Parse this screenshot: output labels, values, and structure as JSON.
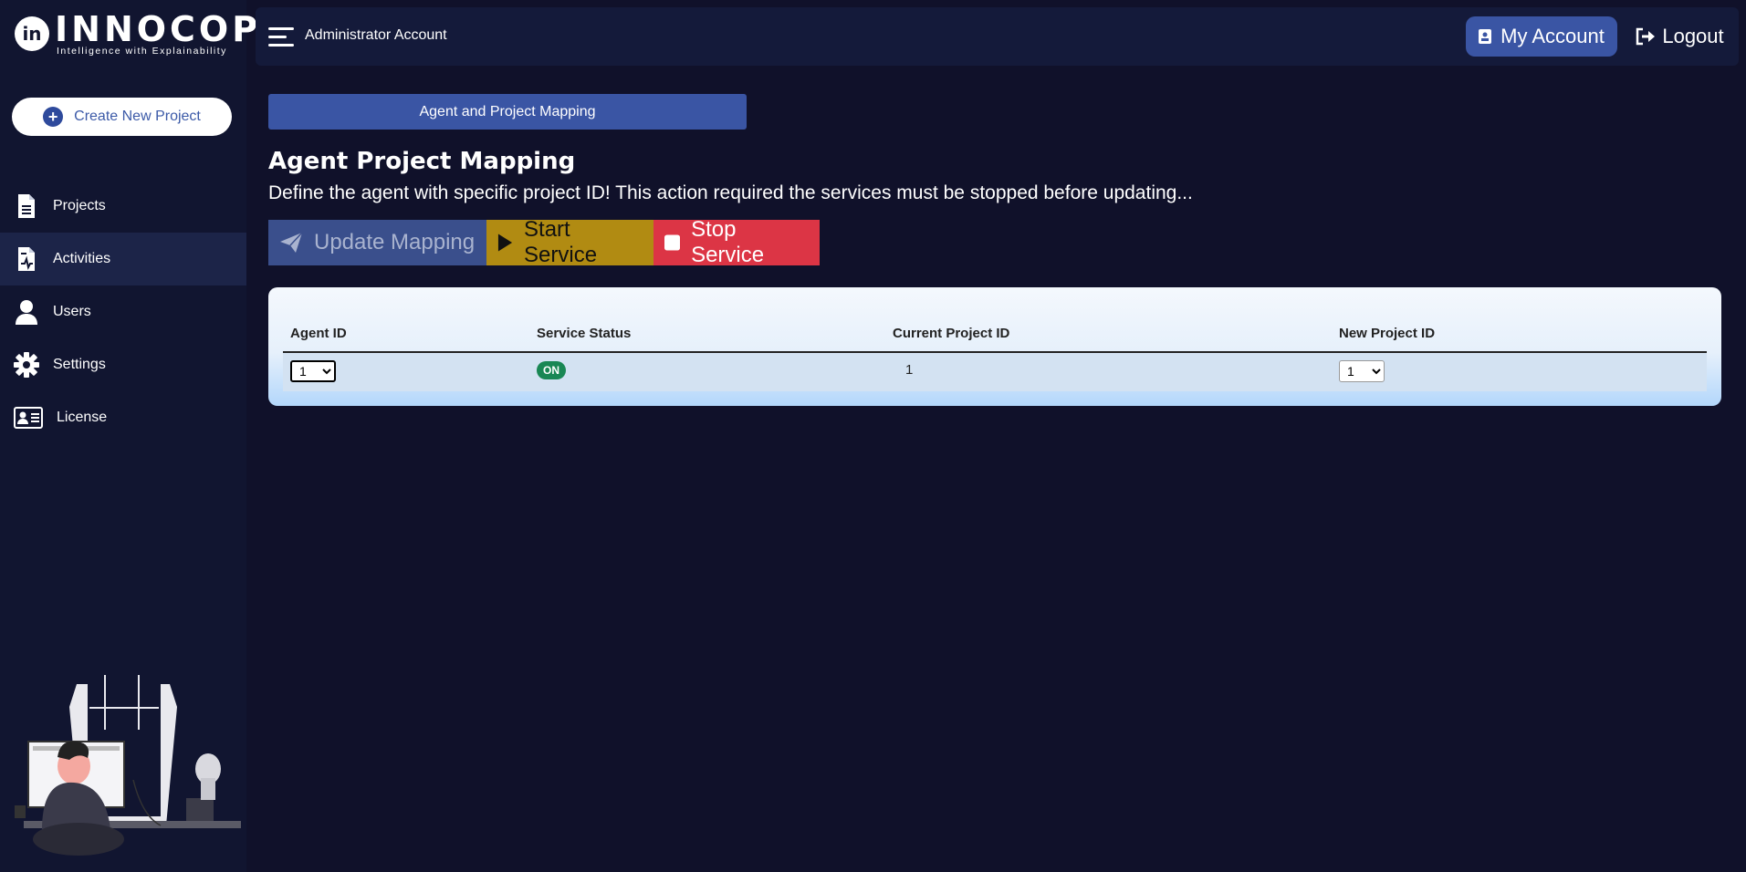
{
  "brand": {
    "name": "INNOCOP",
    "logo_glyph": "in",
    "tagline": "Intelligence with Explainability"
  },
  "sidebar": {
    "create_label": "Create New Project",
    "items": [
      {
        "label": "Projects",
        "icon": "document-icon",
        "active": false
      },
      {
        "label": "Activities",
        "icon": "activity-document-icon",
        "active": true
      },
      {
        "label": "Users",
        "icon": "user-icon",
        "active": false
      },
      {
        "label": "Settings",
        "icon": "gear-icon",
        "active": false
      },
      {
        "label": "License",
        "icon": "id-card-icon",
        "active": false
      }
    ]
  },
  "header": {
    "title": "Administrator Account",
    "my_account_label": "My Account",
    "logout_label": "Logout"
  },
  "main": {
    "tab_label": "Agent and Project Mapping",
    "page_title": "Agent Project Mapping",
    "description": "Define the agent with specific project ID! This action required the services must be stopped before updating...",
    "actions": {
      "update_label": "Update Mapping",
      "start_label": "Start Service",
      "stop_label": "Stop Service"
    },
    "table": {
      "headers": [
        "Agent ID",
        "Service Status",
        "Current Project ID",
        "New Project ID"
      ],
      "rows": [
        {
          "agent_id": "1",
          "status": "ON",
          "current_project_id": "1",
          "new_project_id": "1"
        }
      ]
    }
  },
  "colors": {
    "background": "#10112a",
    "sidebar": "#111530",
    "accent": "#3a55a4",
    "start": "#b18b12",
    "stop": "#dc3545",
    "status_on": "#198754"
  }
}
